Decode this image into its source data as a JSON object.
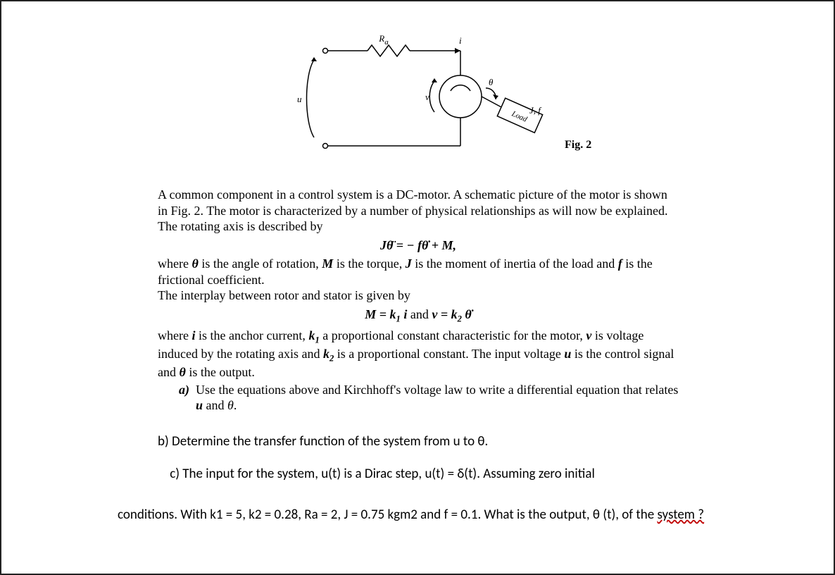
{
  "figure": {
    "caption": "Fig. 2",
    "labels": {
      "Ra": "R",
      "Ra_sub": "a",
      "i": "i",
      "u": "u",
      "v": "v",
      "theta": "θ",
      "Jf": "J, f",
      "Load": "Load"
    }
  },
  "p1": "A common component in a control system is a DC-motor. A schematic picture of the motor is shown in Fig. 2. The motor is characterized by a number of physical relationships as will now be explained. The rotating axis is described by",
  "eq1": "Jθ̈ = − fθ̇ + M,",
  "p2_a": "where ",
  "p2_b": " is the angle of rotation, ",
  "p2_c": " is the torque, ",
  "p2_d": " is the moment of inertia of the load and ",
  "p2_e": " is the frictional coefficient.",
  "p2_f": "The interplay between rotor and stator is given by",
  "sym_theta": "θ",
  "sym_M": "M",
  "sym_J": "J",
  "sym_f": "f",
  "eq2_a": "M = k",
  "eq2_a_sub": "1",
  "eq2_b": " i",
  "eq2_and": "  and  ",
  "eq2_c": "v = k",
  "eq2_c_sub": "2",
  "eq2_d": " θ̇",
  "p3_a": "where ",
  "sym_i": "i",
  "p3_b": " is the anchor current, ",
  "sym_k1": "k",
  "sym_k1_sub": "1",
  "p3_c": " a proportional constant characteristic for the motor, ",
  "sym_v": "v",
  "p3_d": " is voltage induced by the rotating axis and ",
  "sym_k2": "k",
  "sym_k2_sub": "2",
  "p3_e": " is a proportional constant. The input voltage ",
  "sym_u": "u",
  "p3_f": " is the control signal and ",
  "p3_g": " is the output.",
  "a_label": "a)",
  "a_text_1": "Use the equations above and Kirchhoff's voltage law to write a differential equation that relates ",
  "a_text_2": " and ",
  "a_text_3": ".",
  "b_text": "b) Determine the transfer function of the system from u to θ.",
  "c_line1_a": "c) The input for the system, u(t) is a Dirac step, u(t) = δ(t). Assuming zero initial",
  "c_line2": "conditions. With k1 = 5, k2 = 0.28, Ra = 2, J = 0.75 kgm2 and f = 0.1. What is the output, θ (t), of the ",
  "c_squiggle": "system ?"
}
